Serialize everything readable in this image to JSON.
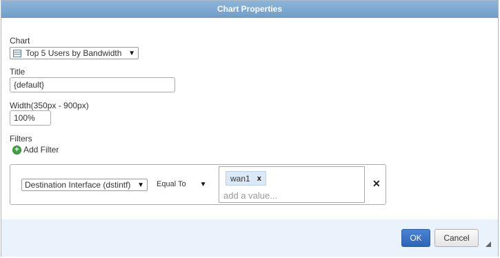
{
  "dialog": {
    "title": "Chart Properties"
  },
  "form": {
    "chart_label": "Chart",
    "chart_value": "Top 5 Users by Bandwidth",
    "title_label": "Title",
    "title_value": "{default}",
    "width_label": "Width(350px - 900px)",
    "width_value": "100%",
    "filters_label": "Filters",
    "add_filter_label": "Add Filter"
  },
  "filter": {
    "field": "Destination Interface (dstintf)",
    "operator": "Equal To",
    "values": [
      "wan1"
    ],
    "value_remove": "x",
    "placeholder": "add a value...",
    "remove": "✕"
  },
  "footer": {
    "ok_label": "OK",
    "cancel_label": "Cancel"
  },
  "icons": {
    "chart": "table-chart-icon",
    "add": "plus-circle-icon",
    "dropdown": "triangle-down-icon",
    "remove": "close-icon",
    "resize": "resize-grip-icon"
  },
  "colors": {
    "titlebar": "#7ea9d1",
    "ok_button": "#3a74c7",
    "footer": "#eaf2fb",
    "add_icon": "#3ea63e",
    "tag": "#dbe9f7"
  }
}
